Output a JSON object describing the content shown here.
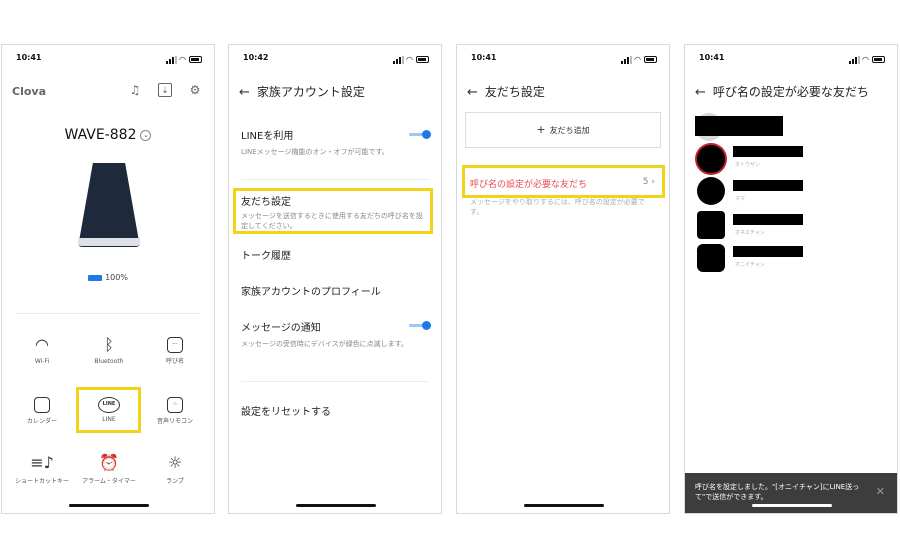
{
  "phone1": {
    "time": "10:41",
    "app_name": "Clova",
    "icons": [
      "music-note-icon",
      "download-icon",
      "gear-icon"
    ],
    "device_name": "WAVE-882",
    "battery": "100%",
    "battery_level": 1.0,
    "tiles": [
      {
        "icon": "wifi-icon",
        "label": "Wi-Fi"
      },
      {
        "icon": "bluetooth-icon",
        "label": "Bluetooth"
      },
      {
        "icon": "speech-bubble-icon",
        "label": "呼び名"
      },
      {
        "icon": "calendar-icon",
        "label": "カレンダー"
      },
      {
        "icon": "line-icon",
        "label": "LINE",
        "icon_text": "LINE"
      },
      {
        "icon": "remote-icon",
        "label": "音声リモコン"
      },
      {
        "icon": "shortcut-icon",
        "label": "ショートカットキー"
      },
      {
        "icon": "alarm-clock-icon",
        "label": "アラーム・タイマー"
      },
      {
        "icon": "lamp-icon",
        "label": "ランプ"
      }
    ]
  },
  "phone2": {
    "time": "10:42",
    "title": "家族アカウント設定",
    "line_use": {
      "title": "LINEを利用",
      "sub": "LINEメッセージ機能のオン・オフが可能です。"
    },
    "friend_settings": {
      "title": "友だち設定",
      "sub": "メッセージを送信するときに使用する友だちの呼び名を設定してください。"
    },
    "talk_history": "トーク履歴",
    "profile": "家族アカウントのプロフィール",
    "notify": {
      "title": "メッセージの通知",
      "sub": "メッセージの受信時にデバイスが緑色に点滅します。"
    },
    "reset": "設定をリセットする"
  },
  "phone3": {
    "time": "10:41",
    "title": "友だち設定",
    "add_friend": "友だち追加",
    "required_label": "呼び名の設定が必要な友だち",
    "required_count": "5",
    "required_sub": "メッセージをやり取りするには、呼び名の設定が必要です。"
  },
  "phone4": {
    "time": "10:41",
    "title": "呼び名の設定が必要な友だち",
    "friend_sublabels": [
      "オトウサン",
      "ママ",
      "オネエチャン",
      "オニイチャン"
    ],
    "toast": "呼び名を設定しました。\"[オニイチャン]にLINE送って\"で送信ができます。"
  }
}
